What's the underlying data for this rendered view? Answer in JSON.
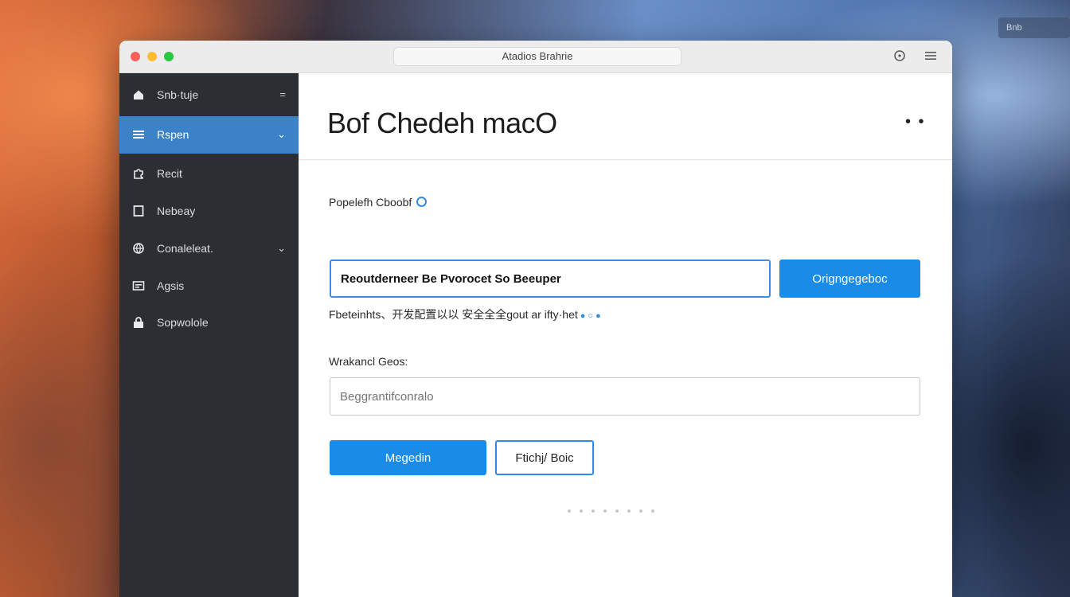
{
  "window": {
    "title": "Atadios Brahrie"
  },
  "desktop": {
    "badge": "Bnb"
  },
  "titlebar": {
    "clock_icon": "clock-icon",
    "menu_icon": "hamburger-icon"
  },
  "sidebar": {
    "items": [
      {
        "label": "Snb·tuje",
        "icon": "home-icon",
        "right": "="
      },
      {
        "label": "Rspen",
        "icon": "list-icon",
        "right": "⌄",
        "active": true
      },
      {
        "label": "Recit",
        "icon": "puzzle-icon",
        "right": ""
      },
      {
        "label": "Nebeay",
        "icon": "square-icon",
        "right": ""
      },
      {
        "label": "Conaleleat.",
        "icon": "globe-icon",
        "right": "⌄"
      },
      {
        "label": "Agsis",
        "icon": "card-icon",
        "right": ""
      },
      {
        "label": "Sopwolole",
        "icon": "lock-icon",
        "right": ""
      }
    ]
  },
  "main": {
    "title": "Bof Chedeh macO",
    "more": "• •",
    "primary_label": "Popelefh Cboobf",
    "primary_value": "Reoutderneer Be Pvorocet So Beeuper",
    "apply_button": "Origngegeboc",
    "hint": "Fbeteinhts、开发配置以以 安全全全gout ar ifty·het",
    "secondary_label": "Wrakancl Geos:",
    "secondary_placeholder": "Beggrantifconralo",
    "submit_button": "Megedin",
    "secondary_button": "Ftichj/ Boic"
  },
  "colors": {
    "accent": "#1a8ce8",
    "sidebar_bg": "#2b2e32",
    "sidebar_active": "#3b82c9"
  }
}
